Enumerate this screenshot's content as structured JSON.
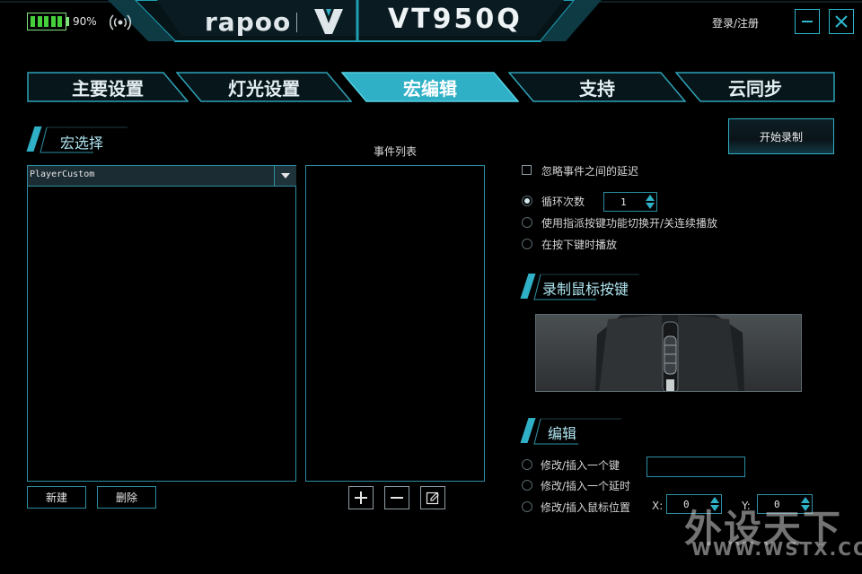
{
  "header": {
    "battery_pct": "90%",
    "battery_level": 0.9,
    "brand": "rapoo",
    "model": "VT950Q",
    "login": "登录/注册"
  },
  "tabs": [
    {
      "label": "主要设置",
      "active": false
    },
    {
      "label": "灯光设置",
      "active": false
    },
    {
      "label": "宏编辑",
      "active": true
    },
    {
      "label": "支持",
      "active": false
    },
    {
      "label": "云同步",
      "active": false
    }
  ],
  "macro_select": {
    "title": "宏选择",
    "selected": "PlayerCustom",
    "new_label": "新建",
    "delete_label": "删除"
  },
  "events": {
    "title": "事件列表"
  },
  "record": {
    "start_label": "开始录制",
    "ignore_delay": "忽略事件之间的延迟",
    "loop_count_label": "循环次数",
    "loop_count": "1",
    "toggle_option": "使用指派按键功能切换开/关连续播放",
    "hold_option": "在按下键时播放",
    "selected_option": "loop"
  },
  "mouse_keys": {
    "title": "录制鼠标按键"
  },
  "edit": {
    "title": "编辑",
    "modify_key": "修改/插入一个键",
    "modify_delay": "修改/插入一个延时",
    "modify_position": "修改/插入鼠标位置",
    "x_label": "X:",
    "x_value": "0",
    "y_label": "Y:",
    "y_value": "0"
  },
  "watermark": {
    "text": "外设天下",
    "url": "WWW.WSTX.COM"
  },
  "colors": {
    "accent": "#2fb0c6",
    "battery": "#46d13c",
    "background": "#000000"
  }
}
